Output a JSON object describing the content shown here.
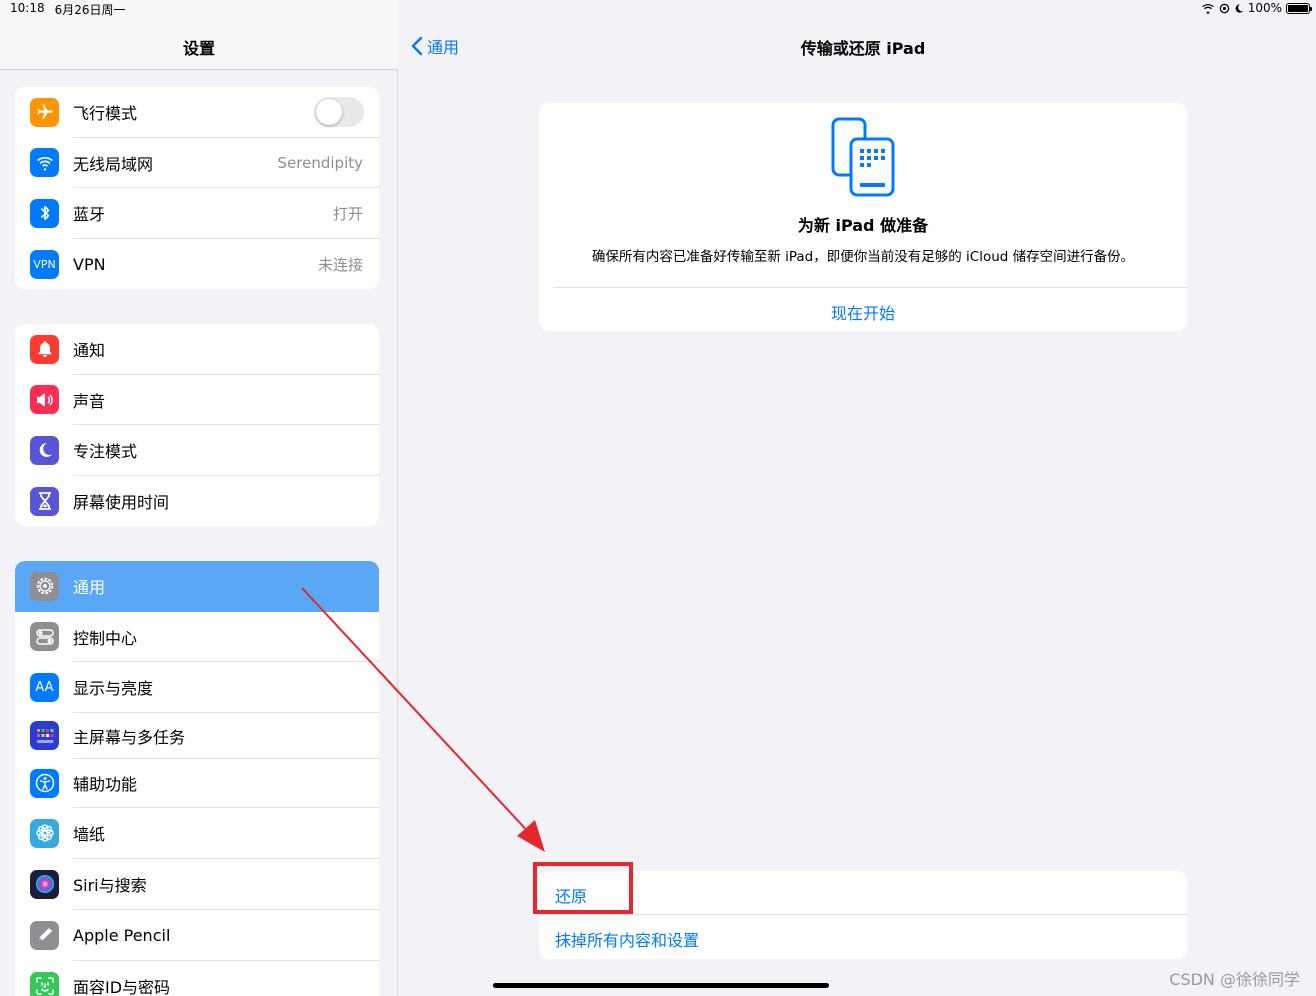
{
  "status": {
    "time": "10:18",
    "date": "6月26日周一",
    "battery": "100%"
  },
  "sidebar": {
    "title": "设置",
    "groups": [
      [
        {
          "label": "飞行模式",
          "icon": "airplane-icon",
          "color": "#ff9500",
          "toggle": false
        },
        {
          "label": "无线局域网",
          "icon": "wifi-icon",
          "color": "#007aff",
          "value": "Serendipity"
        },
        {
          "label": "蓝牙",
          "icon": "bluetooth-icon",
          "color": "#007aff",
          "value": "打开"
        },
        {
          "label": "VPN",
          "icon": "vpn-icon",
          "icon_text": "VPN",
          "color": "#007aff",
          "value": "未连接"
        }
      ],
      [
        {
          "label": "通知",
          "icon": "bell-icon",
          "color": "#ff3b30"
        },
        {
          "label": "声音",
          "icon": "speaker-icon",
          "color": "#ff2d55"
        },
        {
          "label": "专注模式",
          "icon": "moon-icon",
          "color": "#5856d6"
        },
        {
          "label": "屏幕使用时间",
          "icon": "hourglass-icon",
          "color": "#5856d6"
        }
      ],
      [
        {
          "label": "通用",
          "icon": "gear-icon",
          "color": "#8e8e93",
          "selected": true
        },
        {
          "label": "控制中心",
          "icon": "switches-icon",
          "color": "#8e8e93"
        },
        {
          "label": "显示与亮度",
          "icon": "text-size-icon",
          "icon_text": "AA",
          "color": "#007aff"
        },
        {
          "label": "主屏幕与多任务",
          "icon": "grid-icon",
          "color": "#2c3bd1"
        },
        {
          "label": "辅助功能",
          "icon": "accessibility-icon",
          "color": "#007aff"
        },
        {
          "label": "墙纸",
          "icon": "flower-icon",
          "color": "#35aadc"
        },
        {
          "label": "Siri与搜索",
          "icon": "siri-icon",
          "color": "#1c1c3a"
        },
        {
          "label": "Apple Pencil",
          "icon": "pencil-icon",
          "color": "#8e8e93"
        },
        {
          "label": "面容ID与密码",
          "icon": "face-id-icon",
          "color": "#34c759"
        }
      ]
    ]
  },
  "detail": {
    "back_label": "通用",
    "title": "传输或还原 iPad",
    "prepare": {
      "title": "为新 iPad 做准备",
      "description": "确保所有内容已准备好传输至新 iPad，即便你当前没有足够的 iCloud 储存空间进行备份。",
      "action": "现在开始"
    },
    "reset_label": "还原",
    "erase_label": "抹掉所有内容和设置"
  },
  "watermark": "CSDN @徐徐同学",
  "colors": {
    "accent": "#007aff",
    "selection": "#5aa8f5",
    "annotation": "#e8262d"
  }
}
